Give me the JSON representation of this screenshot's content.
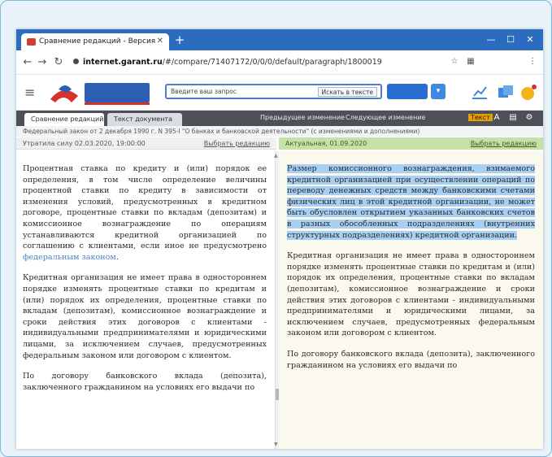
{
  "browser": {
    "tab_title": "Сравнение редакций - Версия",
    "new_tab": "+",
    "url_bold": "internet.garant.ru",
    "url_rest": "/#/compare/71407172/0/0/0/default/paragraph/1800019",
    "controls": [
      "—",
      "☐",
      "✕"
    ]
  },
  "app": {
    "logo_text": "ГАРАНТ",
    "search_placeholder": "Введите ваш запрос",
    "search_scope": "Искать в тексте",
    "doc_title": "Федеральный закон от 2 декабря 1990 г. N 395-I \"О банках и банковской деятельности\" (с изменениями и дополнениями)"
  },
  "toolbar": {
    "tab_active": "Сравнение редакций",
    "tab_inactive": "Текст документа",
    "action1": "Предыдущее изменение",
    "action2": "Следующее изменение",
    "action_hl": "Текст"
  },
  "left_head": {
    "edition": "Утратила силу 02.03.2020, 19:00:00",
    "link": "Выбрать редакцию"
  },
  "right_head": {
    "edition": "Актуальная, 01.09.2020",
    "link": "Выбрать редакцию"
  },
  "left_text": {
    "p1": "Процентная ставка по кредиту и (или) порядок ее определения, в том числе определение величины процентной ставки по кредиту в зависимости от изменения условий, предусмотренных в кредитном договоре, процентные ставки по вкладам (депозитам) и комиссионное вознаграждение по операциям устанавливаются кредитной организацией по соглашению с клиентами, если иное не предусмотрено",
    "p1_link": "федеральным законом",
    "p1_end": ".",
    "p2": "Кредитная организация не имеет права в одностороннем порядке изменять процентные ставки по кредитам и (или) порядок их определения, процентные ставки по вкладам (депозитам), комиссионное вознаграждение и сроки действия этих договоров с клиентами - индивидуальными предпринимателями и юридическими лицами, за исключением случаев, предусмотренных федеральным законом или договором с клиентом.",
    "p3": "По договору банковского вклада (депозита), заключенного гражданином на условиях его выдачи по"
  },
  "right_text": {
    "p1": "Размер комиссионного вознаграждения, взимаемого кредитной организацией при осуществлении операций по переводу денежных средств между банковскими счетами физических лиц в этой кредитной организации, не может быть обусловлен открытием указанных банковских счетов в разных обособленных подразделениях (внутренних структурных подразделениях) кредитной организации.",
    "p2": "Кредитная организация не имеет права в одностороннем порядке изменять процентные ставки по кредитам и (или) порядок их определения, процентные ставки по вкладам (депозитам), комиссионное вознаграждение и сроки действия этих договоров с клиентами - индивидуальными предпринимателями и юридическими лицами, за исключением случаев, предусмотренных федеральным законом или договором с клиентом.",
    "p3": "По договору банковского вклада (депозита), заключенного гражданином на условиях его выдачи по"
  },
  "colors": {
    "chrome_blue": "#2b6cbf",
    "toolbar_dark": "#4d5157",
    "right_head_green": "#c7e0a6",
    "highlight_blue": "#a8d0f5",
    "right_bg": "#fbf8ee"
  }
}
